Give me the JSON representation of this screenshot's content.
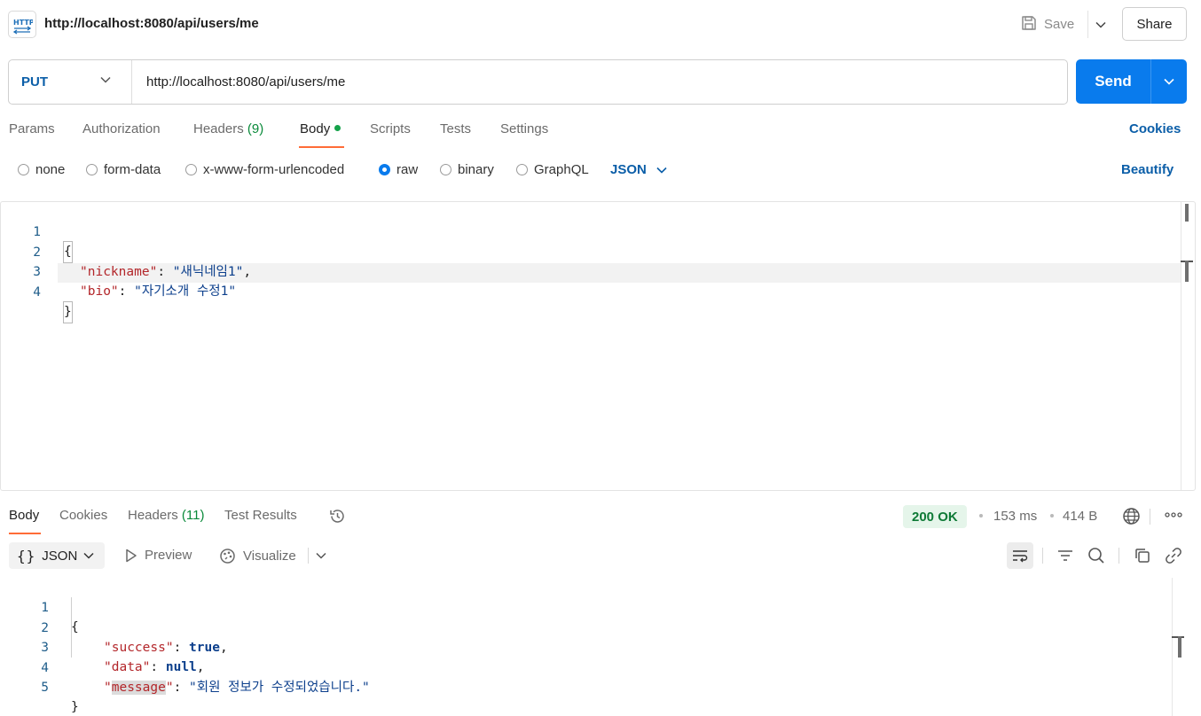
{
  "titlebar": {
    "icon": "http-icon",
    "title": "http://localhost:8080/api/users/me",
    "save_label": "Save",
    "share_label": "Share"
  },
  "request": {
    "method": "PUT",
    "url": "http://localhost:8080/api/users/me",
    "send_label": "Send",
    "tabs": {
      "params": "Params",
      "authorization": "Authorization",
      "headers": "Headers",
      "headers_count": "(9)",
      "body": "Body",
      "scripts": "Scripts",
      "tests": "Tests",
      "settings": "Settings"
    },
    "cookies_label": "Cookies",
    "body_types": {
      "none": "none",
      "form_data": "form-data",
      "urlencoded": "x-www-form-urlencoded",
      "raw": "raw",
      "binary": "binary",
      "graphql": "GraphQL",
      "selected": "raw"
    },
    "language": "JSON",
    "beautify_label": "Beautify",
    "body_lines": {
      "n1": "1",
      "n2": "2",
      "n3": "3",
      "n4": "4",
      "open": "{",
      "k1": "\"nickname\"",
      "v1": "\"새닉네임1\"",
      "k2": "\"bio\"",
      "v2": "\"자기소개 수정1\"",
      "close": "}"
    }
  },
  "response": {
    "tabs": {
      "body": "Body",
      "cookies": "Cookies",
      "headers": "Headers",
      "headers_count": "(11)",
      "test_results": "Test Results"
    },
    "status": "200 OK",
    "time": "153 ms",
    "size": "414 B",
    "format": "JSON",
    "preview_label": "Preview",
    "visualize_label": "Visualize",
    "body_lines": {
      "n1": "1",
      "n2": "2",
      "n3": "3",
      "n4": "4",
      "n5": "5",
      "open": "{",
      "k1": "\"success\"",
      "v1": "true",
      "k2": "\"data\"",
      "v2": "null",
      "k3_q1": "\"",
      "k3_word": "message",
      "k3_q2": "\"",
      "v3": "\"회원 정보가 수정되었습니다.\"",
      "close": "}"
    }
  },
  "colors": {
    "accent": "#ff6c37",
    "send": "#097bed",
    "link": "#0b5ea8",
    "status_ok_bg": "#e5f5ea",
    "status_ok_text": "#0e7a36"
  }
}
